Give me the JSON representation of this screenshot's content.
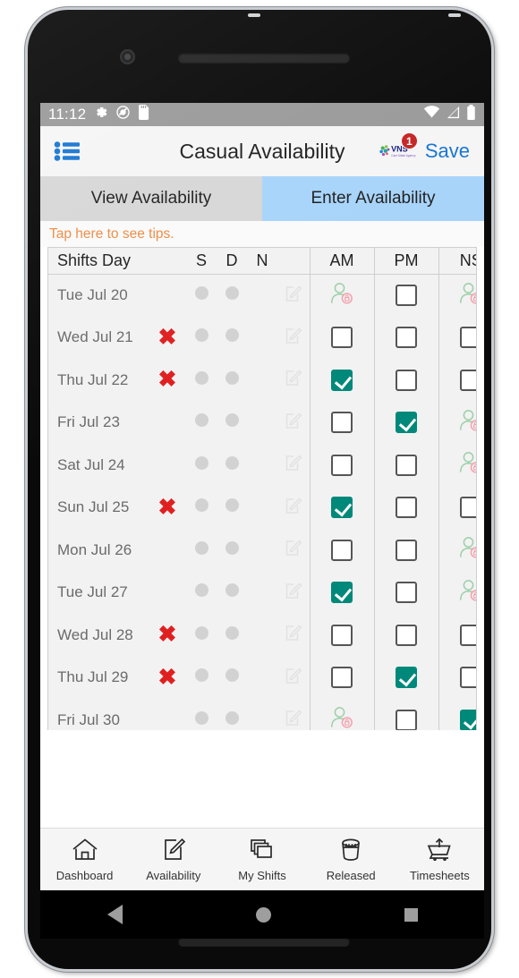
{
  "status_bar": {
    "clock": "11:12",
    "left_icons": [
      "gear-icon",
      "do-not-disturb-icon",
      "sd-card-icon"
    ],
    "right_icons": [
      "wifi-icon",
      "signal-no-service-icon",
      "battery-full-icon"
    ]
  },
  "app_bar": {
    "menu_icon": "list-menu-icon",
    "title": "Casual Availability",
    "logo": {
      "name": "vns-logo",
      "text": "VNS",
      "subtext": "Care Made Agency"
    },
    "badge_count": "1",
    "save_label": "Save",
    "save_color": "#1976d2"
  },
  "tabs": [
    {
      "label": "View Availability",
      "active": false
    },
    {
      "label": "Enter Availability",
      "active": true
    }
  ],
  "tips": {
    "text": "Tap here to see tips.",
    "color": "#ef8b43"
  },
  "table": {
    "headers": [
      "Shifts Day",
      "",
      "S",
      "D",
      "N",
      "AM",
      "PM",
      "NS"
    ],
    "rows": [
      {
        "day": "Tue Jul 20",
        "x": false,
        "am": "locked",
        "pm": "unchecked",
        "ns": "locked"
      },
      {
        "day": "Wed Jul 21",
        "x": true,
        "am": "unchecked",
        "pm": "unchecked",
        "ns": "unchecked"
      },
      {
        "day": "Thu Jul 22",
        "x": true,
        "am": "checked",
        "pm": "unchecked",
        "ns": "unchecked"
      },
      {
        "day": "Fri Jul 23",
        "x": false,
        "am": "unchecked",
        "pm": "checked",
        "ns": "locked"
      },
      {
        "day": "Sat Jul 24",
        "x": false,
        "am": "unchecked",
        "pm": "unchecked",
        "ns": "locked"
      },
      {
        "day": "Sun Jul 25",
        "x": true,
        "am": "checked",
        "pm": "unchecked",
        "ns": "unchecked"
      },
      {
        "day": "Mon Jul 26",
        "x": false,
        "am": "unchecked",
        "pm": "unchecked",
        "ns": "locked"
      },
      {
        "day": "Tue Jul 27",
        "x": false,
        "am": "checked",
        "pm": "unchecked",
        "ns": "locked"
      },
      {
        "day": "Wed Jul 28",
        "x": true,
        "am": "unchecked",
        "pm": "unchecked",
        "ns": "unchecked"
      },
      {
        "day": "Thu Jul 29",
        "x": true,
        "am": "unchecked",
        "pm": "checked",
        "ns": "unchecked"
      },
      {
        "day": "Fri Jul 30",
        "x": false,
        "am": "locked",
        "pm": "unchecked",
        "ns": "checked"
      }
    ],
    "checked_color": "#00897a",
    "x_color": "#e02020"
  },
  "bottom_nav": [
    {
      "label": "Dashboard",
      "icon": "home-icon"
    },
    {
      "label": "Availability",
      "icon": "edit-note-icon"
    },
    {
      "label": "My Shifts",
      "icon": "stacked-pages-icon"
    },
    {
      "label": "Released",
      "icon": "bucket-icon"
    },
    {
      "label": "Timesheets",
      "icon": "cart-upload-icon"
    }
  ],
  "android_nav": {
    "back": "back-triangle-icon",
    "home": "home-circle-icon",
    "recents": "recents-square-icon"
  }
}
